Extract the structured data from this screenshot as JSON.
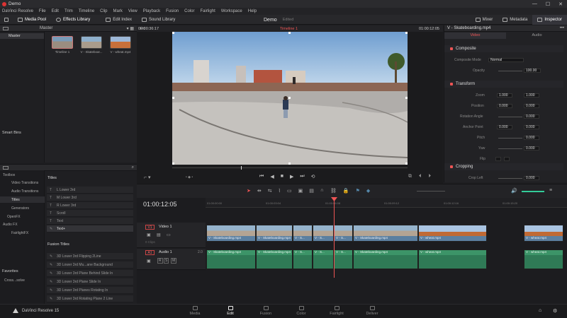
{
  "window": {
    "title": "Demo",
    "controls": [
      "—",
      "☐",
      "✕"
    ]
  },
  "menu": [
    "DaVinci Resolve",
    "File",
    "Edit",
    "Trim",
    "Timeline",
    "Clip",
    "Mark",
    "View",
    "Playback",
    "Fusion",
    "Color",
    "Fairlight",
    "Workspace",
    "Help"
  ],
  "toolbar": {
    "left": [
      "Media Pool",
      "Effects Library",
      "Edit Index",
      "Sound Library"
    ],
    "project_name": "Demo",
    "project_status": "Edited",
    "right": [
      "Mixer",
      "Metadata",
      "Inspector"
    ]
  },
  "mediapool": {
    "bin_label": "Master",
    "sidebar_item": "Master",
    "smart_bins": "Smart Bins",
    "clips": [
      "Timeline 1",
      "V - Skateboar...",
      "V - wheat.mp4"
    ]
  },
  "viewer": {
    "fit": "Fit",
    "source_tc": "00:00:36:17",
    "timeline_name": "Timeline 1",
    "record_tc": "01:00:12:05",
    "dots": "• ◆ •"
  },
  "inspector": {
    "clip_name": "V - Skateboarding.mp4",
    "tabs": [
      "Video",
      "Audio"
    ],
    "composite": {
      "title": "Composite",
      "mode_label": "Composite Mode",
      "mode_value": "Normal",
      "opacity_label": "Opacity",
      "opacity_value": "100.00"
    },
    "transform": {
      "title": "Transform",
      "zoom_label": "Zoom",
      "zoom_x": "1.000",
      "zoom_y": "1.000",
      "position_label": "Position",
      "position_x": "0.000",
      "position_y": "0.000",
      "rotation_label": "Rotation Angle",
      "rotation_value": "0.000",
      "anchor_label": "Anchor Point",
      "anchor_x": "0.000",
      "anchor_y": "0.000",
      "pitch_label": "Pitch",
      "pitch_value": "0.000",
      "yaw_label": "Yaw",
      "yaw_value": "0.000",
      "flip_label": "Flip"
    },
    "cropping": {
      "title": "Cropping",
      "crop_left_label": "Crop Left",
      "crop_left_value": "0.000"
    }
  },
  "effects": {
    "tree": [
      "Toolbox",
      "Video Transitions",
      "Audio Transitions",
      "Titles",
      "Generators",
      "OpenFX",
      "Audio FX",
      "FairlightFX"
    ],
    "favorites_label": "Favorites",
    "favorite_item": "Cross...solve",
    "titles_header": "Titles",
    "titles": [
      "L Lower 3rd",
      "M Lower 3rd",
      "R Lower 3rd",
      "Scroll",
      "Text",
      "Text+"
    ],
    "fusion_header": "Fusion Titles",
    "fusion_titles": [
      "3D Lower 3rd Flipping 2Line",
      "3D Lower 3rd Mu...ane Background",
      "3D Lower 3rd Plane Behind Slide In",
      "3D Lower 3rd Plane Slide In",
      "3D Lower 3rd Planes Rotating In",
      "3D Lower 3rd Rotating Plane 2 Line"
    ]
  },
  "timeline": {
    "timecode": "01:00:12:05",
    "ruler": [
      "01:00:00:00",
      "01:00:03:04",
      "01:00:06:08",
      "01:00:09:12",
      "01:00:12:16",
      "01:00:15:20",
      "01:00:19:00",
      "01:00:22:04",
      "01:00:25:08",
      "01:00:28:12"
    ],
    "video_track": {
      "id": "V1",
      "name": "Video 1",
      "sub": "0 Clips"
    },
    "audio_track": {
      "id": "A1",
      "name": "Audio 1",
      "level": "2.0",
      "icons": [
        "R",
        "S",
        "M"
      ]
    },
    "video_clips": [
      "V - Skateboarding.mp4",
      "V - Skateboarding.mp4",
      "V - S...",
      "V - S...",
      "V - S...",
      "V - Skateboarding.mp4",
      "V - wheat.mp4",
      "V - wheat.mp4"
    ],
    "audio_clips": [
      "V - Skateboarding.mp4",
      "V - Skateboarding.mp4",
      "V - S...",
      "V - S...",
      "V - S...",
      "V - Skateboarding.mp4",
      "V - wheat.mp4",
      "V - wheat.mp4"
    ]
  },
  "pages": [
    "Media",
    "Edit",
    "Fusion",
    "Color",
    "Fairlight",
    "Deliver"
  ],
  "active_page": "Edit",
  "app_name": "DaVinci Resolve 15",
  "colors": {
    "accent": "#e55555",
    "video_clip": "#5b7fa0",
    "audio_clip": "#3c9468",
    "bg": "#1e1e21"
  },
  "icons": [
    "resolve-logo-icon",
    "media-pool-icon",
    "effects-icon",
    "edit-index-icon",
    "sound-library-icon",
    "mixer-icon",
    "metadata-icon",
    "inspector-icon",
    "play-icon",
    "stop-icon",
    "loop-icon",
    "home-icon",
    "gear-icon"
  ]
}
